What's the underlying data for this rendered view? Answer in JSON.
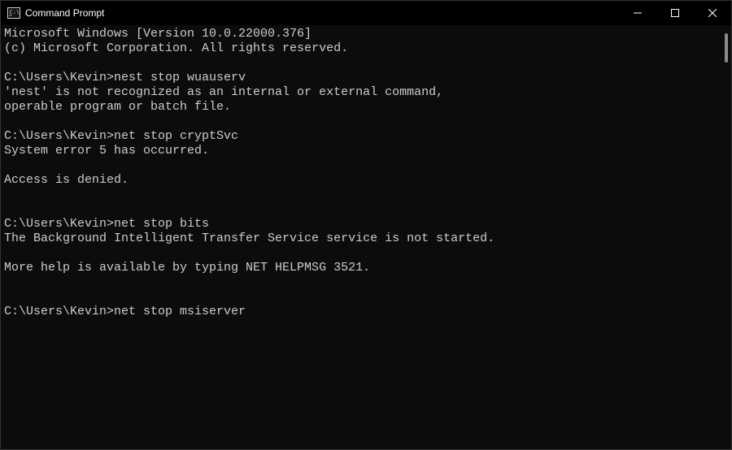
{
  "window": {
    "title": "Command Prompt"
  },
  "terminal": {
    "lines": [
      {
        "type": "text",
        "text": "Microsoft Windows [Version 10.0.22000.376]"
      },
      {
        "type": "text",
        "text": "(c) Microsoft Corporation. All rights reserved."
      },
      {
        "type": "blank"
      },
      {
        "type": "prompt",
        "prompt": "C:\\Users\\Kevin>",
        "command": "nest stop wuauserv"
      },
      {
        "type": "text",
        "text": "'nest' is not recognized as an internal or external command,"
      },
      {
        "type": "text",
        "text": "operable program or batch file."
      },
      {
        "type": "blank"
      },
      {
        "type": "prompt",
        "prompt": "C:\\Users\\Kevin>",
        "command": "net stop cryptSvc"
      },
      {
        "type": "text",
        "text": "System error 5 has occurred."
      },
      {
        "type": "blank"
      },
      {
        "type": "text",
        "text": "Access is denied."
      },
      {
        "type": "blank"
      },
      {
        "type": "blank"
      },
      {
        "type": "prompt",
        "prompt": "C:\\Users\\Kevin>",
        "command": "net stop bits"
      },
      {
        "type": "text",
        "text": "The Background Intelligent Transfer Service service is not started."
      },
      {
        "type": "blank"
      },
      {
        "type": "text",
        "text": "More help is available by typing NET HELPMSG 3521."
      },
      {
        "type": "blank"
      },
      {
        "type": "blank"
      },
      {
        "type": "prompt",
        "prompt": "C:\\Users\\Kevin>",
        "command": "net stop msiserver"
      }
    ]
  }
}
